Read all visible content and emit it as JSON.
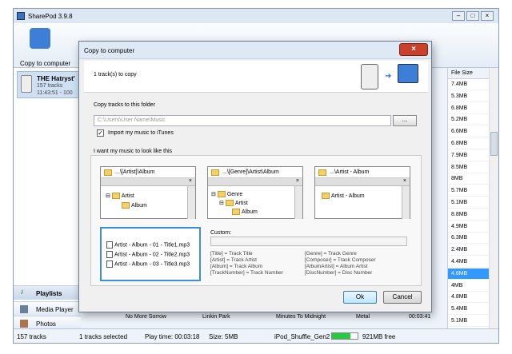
{
  "app": {
    "title": "SharePod 3.9.8"
  },
  "toolbar": {
    "copy_label": "Copy to computer"
  },
  "device": {
    "name": "THE Hatryst'",
    "tracks": "157 tracks",
    "time": "11:43:51 - 100"
  },
  "sidebar": {
    "playlists": "Playlists",
    "media_player": "Media Player",
    "photos": "Photos"
  },
  "file_size": {
    "header": "File Size",
    "values": [
      "7.4MB",
      "5.3MB",
      "6.8MB",
      "5.2MB",
      "6.6MB",
      "6.8MB",
      "7.9MB",
      "8.5MB",
      "8MB",
      "5.7MB",
      "5.1MB",
      "8.8MB",
      "4.9MB",
      "6.3MB",
      "2.4MB",
      "4.4MB",
      "4.6MB",
      "4MB",
      "4.8MB",
      "5.4MB",
      "5.1MB"
    ],
    "selected_index": 16
  },
  "track_row": {
    "title": "No More Sorrow",
    "artist": "Linkin Park",
    "album": "Minutes To Midnight",
    "genre": "Metal",
    "time": "00:03:41"
  },
  "status": {
    "tracks": "157 tracks",
    "selected": "1 tracks selected",
    "play_time": "Play time: 00:03:18",
    "size": "Size: 5MB",
    "device": "iPod_Shuffle_Gen2",
    "free": "921MB free",
    "fill": 0.72
  },
  "dialog": {
    "title": "Copy to computer",
    "count": "1 track(s) to copy",
    "folder_label": "Copy tracks to this folder",
    "folder_path": "C:\\Users\\User Name\\Music",
    "browse_label": "...",
    "import_label": "Import my music to iTunes",
    "import_checked": true,
    "look_label": "I want my music to look like this",
    "patterns": [
      {
        "top": "...\\[Artist]\\Album",
        "rows": [
          "Artist",
          "Album"
        ]
      },
      {
        "top": "...\\[Genre]\\Artist\\Album",
        "rows": [
          "Genre",
          "Artist",
          "Album"
        ]
      },
      {
        "top": "...\\Artist - Album",
        "rows": [
          "Artist - Album"
        ]
      }
    ],
    "files": [
      "Artist - Album - 01 - Title1.mp3",
      "Artist - Album - 02 - Title2.mp3",
      "Artist - Album - 03 - Title3.mp3"
    ],
    "custom_label": "Custom:",
    "legend_left": [
      "[Title] = Track Title",
      "[Artist] = Track Artist",
      "[Album] = Track Album",
      "[TrackNumber] = Track Number"
    ],
    "legend_right": [
      "[Genre] = Track Genre",
      "[Composer] = Track Composer",
      "[AlbumArtist] = Album Artist",
      "[DiscNumber] = Disc Number"
    ],
    "ok_label": "Ok",
    "cancel_label": "Cancel"
  }
}
